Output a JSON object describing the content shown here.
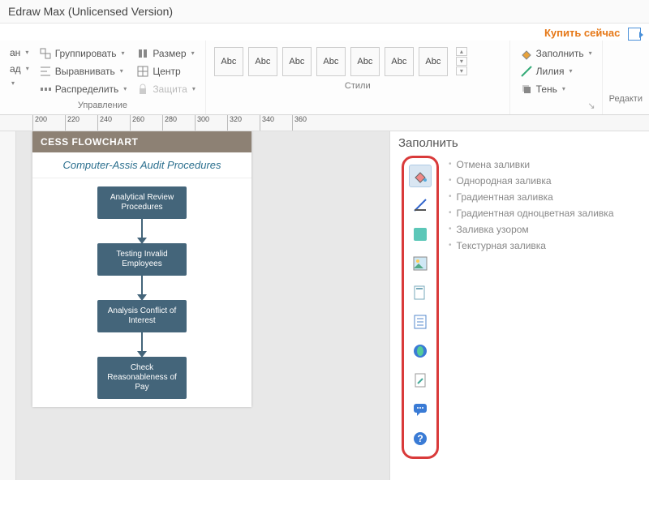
{
  "title_bar": {
    "text": "Edraw Max (Unlicensed Version)"
  },
  "buy_link": {
    "label": "Купить сейчас"
  },
  "ribbon": {
    "manage": {
      "col1": {
        "plan": "ан",
        "back": "ад",
        "down": ""
      },
      "col2": {
        "group": "Группировать",
        "align": "Выравнивать",
        "distribute": "Распределить"
      },
      "col3": {
        "size": "Размер",
        "center": "Центр",
        "protect": "Защита"
      },
      "label": "Управление"
    },
    "styles": {
      "items": [
        "Abc",
        "Abc",
        "Abc",
        "Abc",
        "Abc",
        "Abc",
        "Abc"
      ],
      "label": "Стили"
    },
    "fill": {
      "fill": "Заполнить",
      "line": "Лилия",
      "shadow": "Тень"
    },
    "edit": {
      "label": "Редакти"
    }
  },
  "ruler_ticks": [
    "200",
    "220",
    "240",
    "260",
    "280",
    "300",
    "320",
    "340",
    "360"
  ],
  "flowchart": {
    "header": "CESS FLOWCHART",
    "subtitle": "Computer-Assis Audit Procedures",
    "nodes": [
      "Analytical Review Procedures",
      "Testing Invalid Employees",
      "Analysis Conflict of Interest",
      "Check Reasonableness of Pay"
    ]
  },
  "sidebar": {
    "title": "Заполнить",
    "options": [
      "Отмена заливки",
      "Однородная заливка",
      "Градиентная заливка",
      "Градиентная одноцветная заливка",
      "Заливка узором",
      "Текстурная заливка"
    ]
  }
}
